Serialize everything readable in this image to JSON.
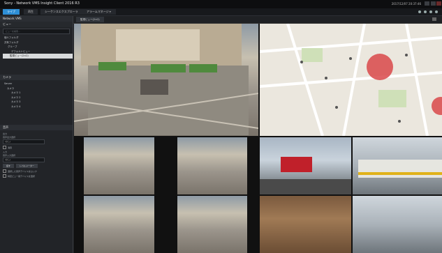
{
  "app": {
    "title": "Sony - Network VMS Insight Client 2016 R3",
    "clock": "2017/12/07 20:37:46"
  },
  "topnav": {
    "tabs": [
      "ライブ",
      "再生",
      "シーケンスエクスプローラ",
      "アラームマネージャ"
    ],
    "active_index": 0
  },
  "sidebar": {
    "header": "Network VMS",
    "views_title": "ビュー",
    "search_placeholder": "ビューを検索...",
    "view_tree": [
      "個人フォルダ",
      "共有フォルダ",
      "グループ",
      "デフォルトビュー",
      "監視ビュー(2×2)"
    ],
    "selected_view_index": 4,
    "cameras_title": "カメラ",
    "camera_tree": [
      "Server",
      "カメラ",
      "カメラ 1",
      "カメラ 2",
      "カメラ 3",
      "カメラ 4"
    ],
    "audio_title": "音声",
    "audio": {
      "output_label": "出力",
      "output_sublabel": "音声出力選択",
      "output_value": "(なし)",
      "mute_label": "消音",
      "input_label": "入力",
      "input_sublabel": "音声入力選択",
      "input_value": "(なし)",
      "talk_button": "話す",
      "level_button": "レベルメーター",
      "check1": "選択した音声デバイスをロック",
      "check2": "特定ビュー用デバイスを選択"
    }
  },
  "viewbar": {
    "view_tab": "監視ビュー(2×2)"
  },
  "map_markers_color": "#d9484a",
  "accent_color": "#2e8fd6"
}
